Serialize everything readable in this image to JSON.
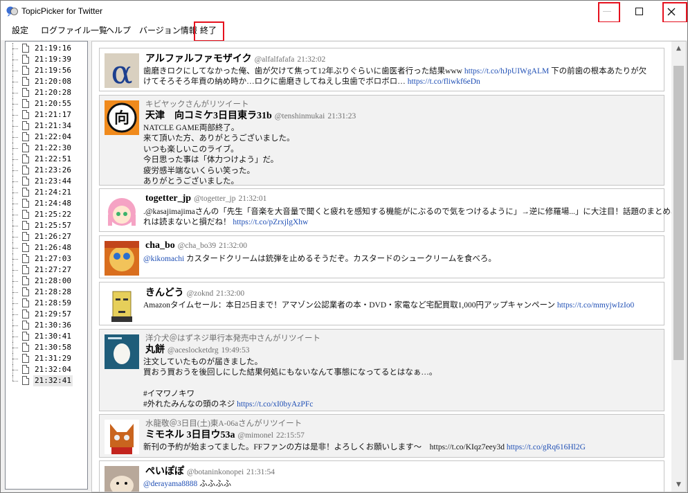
{
  "window": {
    "title": "TopicPicker for Twitter"
  },
  "titlebar_buttons": {
    "minimize": "—",
    "maximize": "□",
    "close": "✕"
  },
  "menu": [
    "設定",
    "ログファイル一覧",
    "ヘルプ",
    "バージョン情報",
    "終了"
  ],
  "log_files": [
    "21:19:16",
    "21:19:39",
    "21:19:56",
    "21:20:08",
    "21:20:28",
    "21:20:55",
    "21:21:17",
    "21:21:34",
    "21:22:04",
    "21:22:30",
    "21:22:51",
    "21:23:26",
    "21:23:44",
    "21:24:21",
    "21:24:48",
    "21:25:22",
    "21:25:57",
    "21:26:27",
    "21:26:48",
    "21:27:03",
    "21:27:27",
    "21:28:00",
    "21:28:28",
    "21:28:59",
    "21:29:57",
    "21:30:36",
    "21:30:41",
    "21:30:58",
    "21:31:29",
    "21:32:04",
    "21:32:41"
  ],
  "tweets": [
    {
      "retweeted_by": "",
      "name": "アルファルファモザイク",
      "handle": "@alfalfafafa",
      "time": "21:32:02",
      "lines": [
        [
          {
            "t": "歯磨きロクにしてなかった俺、歯が欠けて焦って12年ぶりぐらいに歯医者行った結果www "
          },
          {
            "t": "https://t.co/hJpUIWgALM",
            "link": true
          },
          {
            "t": " 下の前歯の根本あたりが欠"
          }
        ],
        [
          {
            "t": "けてそろそろ年貢の納め時か…ロクに歯磨きしてねえし虫歯でボロボロ… "
          },
          {
            "t": "https://t.co/fliwkf6eDn",
            "link": true
          }
        ]
      ],
      "avatar": "alfalfa-logo-icon"
    },
    {
      "retweeted_by": "キビヤックさんがリツイート",
      "name": "天津　向コミケ3日目東ラ31b",
      "handle": "@tenshinmukai",
      "time": "21:31:23",
      "lines": [
        [
          {
            "t": "NATCLE GAME両部終了。"
          }
        ],
        [
          {
            "t": "来て頂いた方、ありがとうございました。"
          }
        ],
        [
          {
            "t": "いつも楽しいこのライブ。"
          }
        ],
        [
          {
            "t": "今日思った事は「体力つけよう」だ。"
          }
        ],
        [
          {
            "t": "疲労感半端ないくらい笑った。"
          }
        ],
        [
          {
            "t": "ありがとうございました。"
          }
        ]
      ],
      "avatar": "mukai-kanji-icon"
    },
    {
      "retweeted_by": "",
      "name": "togetter_jp",
      "handle": "@togetter_jp",
      "time": "21:32:01",
      "lines": [
        [
          {
            "t": ".@kasajimajimaさんの「先生「音楽を大音量で聞くと疲れを感知する機能がにぶるので気をつけるように」→逆に修羅場...」に大注目！話題のまとめ、こ"
          }
        ],
        [
          {
            "t": "れは読まないと損だね！ "
          },
          {
            "t": "https://t.co/pZrxjlgXhw",
            "link": true
          }
        ]
      ],
      "avatar": "togetter-character-icon"
    },
    {
      "retweeted_by": "",
      "name": "cha_bo",
      "handle": "@cha_bo39",
      "time": "21:32:00",
      "lines": [
        [
          {
            "t": "@kikomachi",
            "link": true
          },
          {
            "t": " カスタードクリームは銃弾を止めるそうだぞ。カスタードのシュークリームを食べろ。"
          }
        ]
      ],
      "avatar": "cha-bo-face-icon"
    },
    {
      "retweeted_by": "",
      "name": "きんどう",
      "handle": "@zoknd",
      "time": "21:32:00",
      "lines": [
        [
          {
            "t": "Amazonタイムセール：本日25日まで！アマゾン公認業者の本・DVD・家電など宅配買取1,000円アップキャンペーン "
          },
          {
            "t": "https://t.co/mmyjwIzIo0",
            "link": true
          }
        ]
      ],
      "avatar": "kindou-mask-icon"
    },
    {
      "retweeted_by": "洋介犬＠はずネジ単行本発売中さんがリツイート",
      "name": "丸餅",
      "handle": "@aceslocketdrg",
      "time": "19:49:53",
      "lines": [
        [
          {
            "t": "注文していたものが届きました。"
          }
        ],
        [
          {
            "t": "買おう買おうを後回しにした結果何処にもないなんて事態になってるとはなぁ…。"
          }
        ],
        [
          {
            "t": ""
          }
        ],
        [
          {
            "t": "#イマワノキワ"
          }
        ],
        [
          {
            "t": "#外れたみんなの頭のネジ "
          },
          {
            "t": "https://t.co/xI0byAzPFc",
            "link": true
          }
        ]
      ],
      "avatar": "egg-icon"
    },
    {
      "retweeted_by": "水龍敬＠3日目(土)東A-06aさんがリツイート",
      "name": "ミモネル 3日目ウ53a",
      "handle": "@mimonel",
      "time": "22:15:57",
      "lines": [
        [
          {
            "t": "新刊の予約が始まってました。FFファンの方は是非！よろしくお願いします〜　https://t.co/KIqz7eey3d "
          },
          {
            "t": "https://t.co/gRq616Hl2G",
            "link": true
          }
        ]
      ],
      "avatar": "cat-mask-icon"
    },
    {
      "retweeted_by": "",
      "name": "ぺいぽぽ",
      "handle": "@botaninkonopei",
      "time": "21:31:54",
      "lines": [
        [
          {
            "t": "@derayama8888",
            "link": true
          },
          {
            "t": " ふふふふ"
          }
        ]
      ],
      "avatar": "hamster-icon"
    }
  ]
}
